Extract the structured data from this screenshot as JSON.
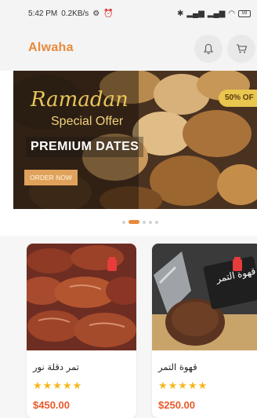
{
  "status_bar": {
    "time": "5:42 PM",
    "speed": "0.2KB/s",
    "battery": "59"
  },
  "app_bar": {
    "brand": "Alwaha",
    "bell_icon": "bell-icon",
    "cart_icon": "cart-icon"
  },
  "banner": {
    "title_script": "Ramadan",
    "subtitle": "Special Offer",
    "headline": "PREMIUM DATES",
    "button_label": "ORDER NOW",
    "offer_badge": "50% OF"
  },
  "carousel": {
    "active_index": 1,
    "total": 5
  },
  "products": [
    {
      "name": "تمر دقلة نور",
      "rating": 5,
      "stars": "★★★★★",
      "price": "$450.00"
    },
    {
      "name": "قهوة التمر",
      "image_text": "قهوة التمر",
      "rating": 5,
      "stars": "★★★★★",
      "price": "$250.00"
    }
  ],
  "colors": {
    "accent": "#e8893c",
    "price": "#e85a2a",
    "star": "#f5b81d",
    "favorite": "#e73c3c"
  }
}
